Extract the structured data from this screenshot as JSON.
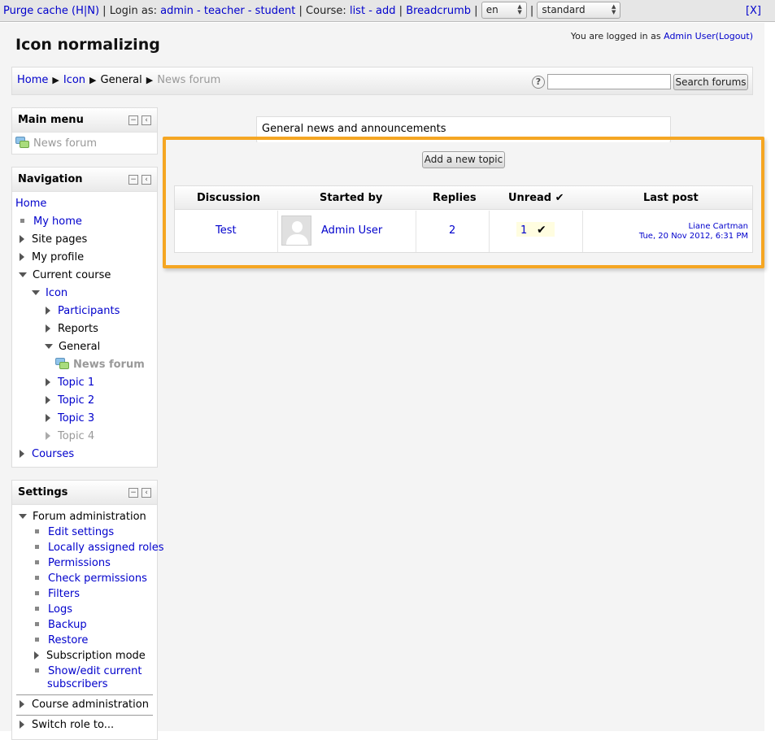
{
  "devbar": {
    "purge": "Purge cache",
    "purge_hn": "(H|N)",
    "login_as": "Login as:",
    "admin": "admin",
    "teacher": "teacher",
    "student": "student",
    "course_label": "Course:",
    "list": "list",
    "add": "add",
    "breadcrumb": "Breadcrumb",
    "lang": "en",
    "theme": "standard",
    "close": "[X]"
  },
  "header": {
    "title": "Icon normalizing",
    "logged_prefix": "You are logged in as",
    "user": "Admin User",
    "logout": "(Logout)"
  },
  "breadcrumb": {
    "items": [
      "Home",
      "Icon",
      "General",
      "News forum"
    ],
    "sep": "▶"
  },
  "search": {
    "help": "?",
    "value": "",
    "button": "Search forums"
  },
  "main_menu": {
    "title": "Main menu",
    "items": [
      "News forum"
    ]
  },
  "navigation": {
    "title": "Navigation",
    "items": [
      "Home",
      "My home",
      "Site pages",
      "My profile",
      "Current course",
      "Icon",
      "Participants",
      "Reports",
      "General",
      "News forum",
      "Topic 1",
      "Topic 2",
      "Topic 3",
      "Topic 4",
      "Courses"
    ]
  },
  "settings": {
    "title": "Settings",
    "forum_admin": "Forum administration",
    "items": [
      "Edit settings",
      "Locally assigned roles",
      "Permissions",
      "Check permissions",
      "Filters",
      "Logs",
      "Backup",
      "Restore",
      "Subscription mode"
    ],
    "show_edit_1": "Show/edit current",
    "show_edit_2": "subscribers",
    "course_admin": "Course administration",
    "switch_role": "Switch role to..."
  },
  "forum": {
    "intro": "General news and announcements",
    "add_topic": "Add a new topic",
    "headers": {
      "discussion": "Discussion",
      "started_by": "Started by",
      "replies": "Replies",
      "unread": "Unread",
      "last_post": "Last post"
    },
    "rows": [
      {
        "discussion": "Test",
        "started_by": "Admin User",
        "replies": "2",
        "unread": "1",
        "last_post_user": "Liane Cartman",
        "last_post_date": "Tue, 20 Nov 2012, 6:31 PM"
      }
    ]
  },
  "icons": {
    "check": "✔",
    "collapse": "−",
    "dock": "‹"
  },
  "colors": {
    "highlight": "#f5a623",
    "link": "#0000cc"
  }
}
